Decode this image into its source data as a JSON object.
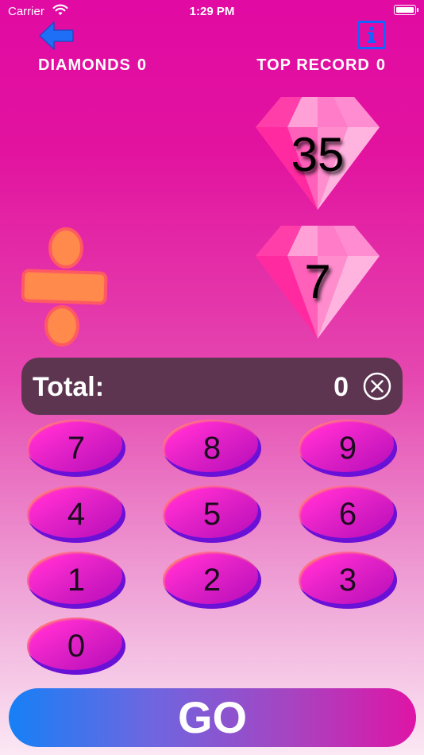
{
  "status_bar": {
    "carrier": "Carrier",
    "time": "1:29 PM"
  },
  "header": {
    "diamonds_label": "DIAMONDS",
    "diamonds_value": "0",
    "top_record_label": "TOP RECORD",
    "top_record_value": "0",
    "back_icon": "back-arrow-icon",
    "info_icon": "info-icon"
  },
  "problem": {
    "operand_1": "35",
    "operand_2": "7",
    "operator_icon": "divide-icon"
  },
  "total": {
    "label": "Total:",
    "value": "0",
    "clear_icon": "clear-circle-x-icon"
  },
  "keypad": {
    "keys": [
      "7",
      "8",
      "9",
      "4",
      "5",
      "6",
      "1",
      "2",
      "3",
      "0"
    ]
  },
  "go_button": {
    "label": "GO"
  },
  "colors": {
    "background_top": "#e10aa3",
    "background_bottom": "#fbe8f4",
    "total_bar": "#5d3550",
    "info_icon": "#1464ff",
    "back_icon": "#1e6ff5",
    "operator": "#ff8a4c",
    "go_gradient_start": "#1680f6",
    "go_gradient_end": "#df14a6"
  }
}
